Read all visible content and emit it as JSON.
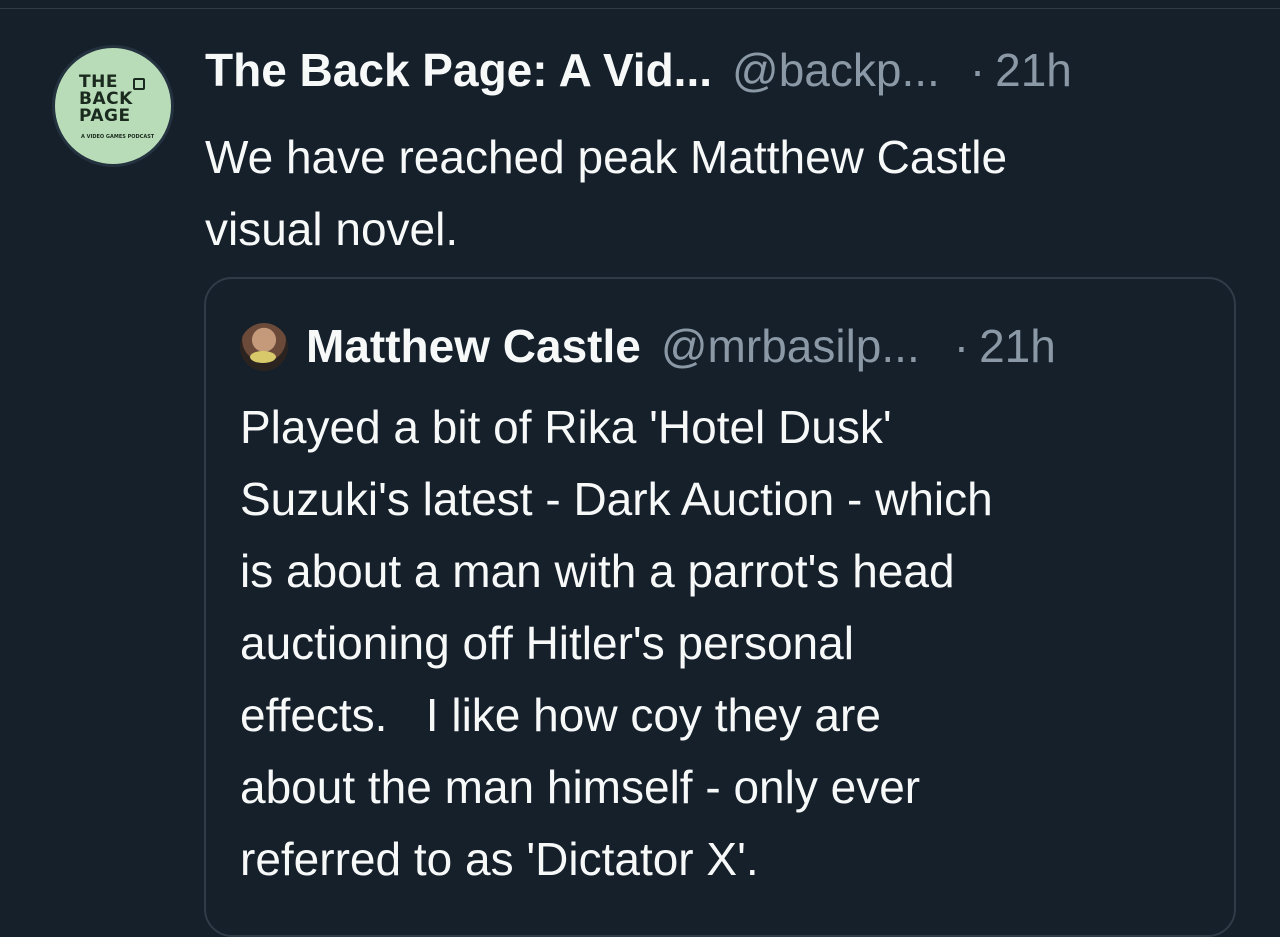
{
  "tweet": {
    "display_name": "The Back Page: A Vid...",
    "handle": "@backp...",
    "separator": "·",
    "time": "21h",
    "avatar_icon": "back-page-podcast-logo",
    "avatar_lines": [
      "THE",
      "BACK",
      "PAGE"
    ],
    "avatar_sub": "A VIDEO GAMES PODCAST",
    "text": "We have reached peak Matthew Castle\nvisual novel."
  },
  "quoted_tweet": {
    "display_name": "Matthew Castle",
    "handle": "@mrbasilp...",
    "separator": "·",
    "time": "21h",
    "avatar_icon": "user-avatar-photo",
    "text": "Played a bit of Rika 'Hotel Dusk'\nSuzuki's latest - Dark Auction - which\nis about a man with a parrot's head\nauctioning off Hitler's personal\neffects.   I like how coy they are\nabout the man himself - only ever\nreferred to as 'Dictator X'."
  },
  "colors": {
    "background": "#15202b",
    "text_primary": "#f7f9f9",
    "text_secondary": "#8b98a5",
    "border": "#2f3b47"
  }
}
